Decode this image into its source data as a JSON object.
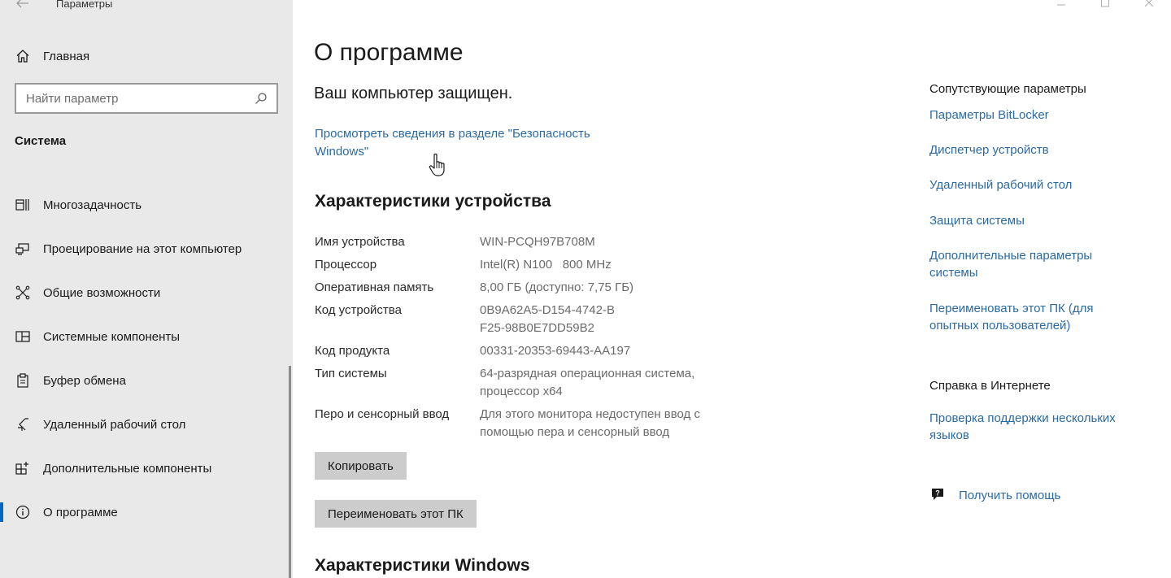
{
  "window": {
    "app_title": "Параметры"
  },
  "sidebar": {
    "home_label": "Главная",
    "search_placeholder": "Найти параметр",
    "section_title": "Система",
    "items": [
      {
        "label": "Многозадачность",
        "icon": "multitasking-icon"
      },
      {
        "label": "Проецирование на этот компьютер",
        "icon": "projecting-icon"
      },
      {
        "label": "Общие возможности",
        "icon": "shared-experiences-icon"
      },
      {
        "label": "Системные компоненты",
        "icon": "system-components-icon"
      },
      {
        "label": "Буфер обмена",
        "icon": "clipboard-icon"
      },
      {
        "label": "Удаленный рабочий стол",
        "icon": "remote-desktop-icon"
      },
      {
        "label": "Дополнительные компоненты",
        "icon": "optional-features-icon"
      },
      {
        "label": "О программе",
        "icon": "info-icon",
        "active": true
      }
    ]
  },
  "main": {
    "page_title": "О программе",
    "protected_text": "Ваш компьютер защищен.",
    "security_link": "Просмотреть сведения в разделе \"Безопасность Windows\"",
    "device_heading": "Характеристики устройства",
    "specs": [
      {
        "key": "Имя устройства",
        "value": "WIN-PCQH97B708M"
      },
      {
        "key": "Процессор",
        "value": "Intel(R) N100   800 MHz"
      },
      {
        "key": "Оперативная память",
        "value": "8,00 ГБ (доступно: 7,75 ГБ)"
      },
      {
        "key": "Код устройства",
        "value": "0B9A62A5-D154-4742-BF25-98B0E7DD59B2"
      },
      {
        "key": "Код продукта",
        "value": "00331-20353-69443-AA197"
      },
      {
        "key": "Тип системы",
        "value": "64-разрядная операционная система, процессор x64"
      },
      {
        "key": "Перо и сенсорный ввод",
        "value": "Для этого монитора недоступен ввод с помощью пера и сенсорный ввод"
      }
    ],
    "copy_button": "Копировать",
    "rename_button": "Переименовать этот ПК",
    "windows_heading": "Характеристики Windows"
  },
  "related": {
    "title": "Сопутствующие параметры",
    "links": [
      "Параметры BitLocker",
      "Диспетчер устройств",
      "Удаленный рабочий стол",
      "Защита системы",
      "Дополнительные параметры системы",
      "Переименовать этот ПК (для опытных пользователей)"
    ],
    "help_title": "Справка в Интернете",
    "help_link": "Проверка поддержки нескольких языков",
    "get_help": "Получить помощь"
  },
  "colors": {
    "link": "#2b6aa3",
    "sidebar_bg": "#e9e9e9",
    "accent": "#0067c0",
    "button_bg": "#cccccc"
  }
}
